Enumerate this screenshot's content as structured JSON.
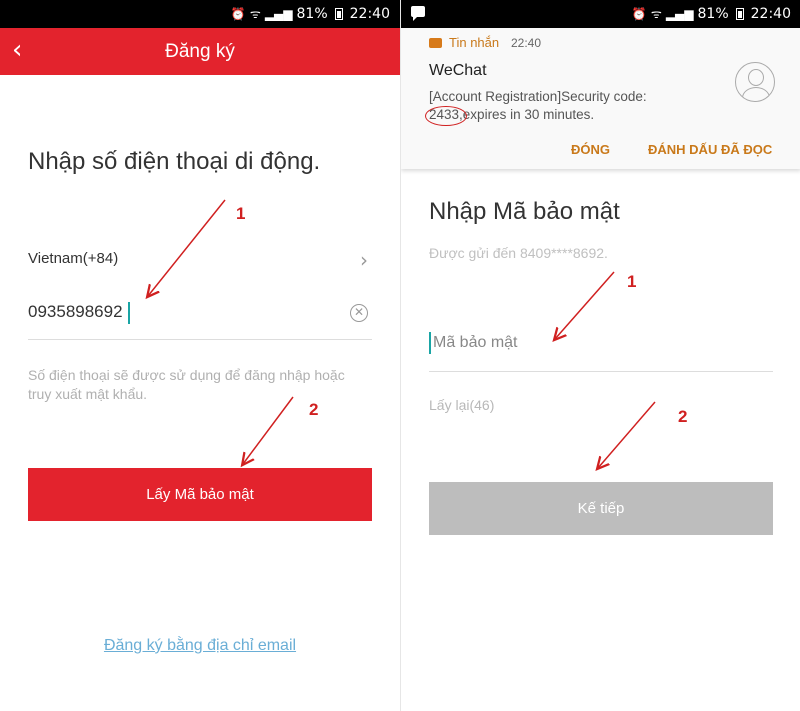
{
  "status_bar": {
    "battery": "81%",
    "time": "22:40"
  },
  "left": {
    "title": "Đăng ký",
    "heading": "Nhập số điện thoại di động.",
    "country": "Vietnam(+84)",
    "phone_value": "0935898692",
    "hint": "Số điện thoại sẽ được sử dụng để đăng nhập hoặc truy xuất mật khẩu.",
    "get_code_button": "Lấy Mã bảo mật",
    "email_link": "Đăng ký bằng địa chỉ email"
  },
  "right": {
    "notification": {
      "app_name": "Tin nhắn",
      "time": "22:40",
      "title": "WeChat",
      "body_line1": "[Account Registration]Security code:",
      "code": "2433",
      "body_line2": ",expires in 30 minutes.",
      "close_action": "ĐÓNG",
      "mark_read_action": "ĐÁNH DẤU ĐÃ ĐỌC"
    },
    "heading": "Nhập Mã bảo mật",
    "sent_to": "Được gửi đến 8409****8692.",
    "code_placeholder": "Mã bảo mật",
    "resend": "Lấy lại(46)",
    "next_button": "Kế tiếp"
  },
  "annotations": {
    "step1": "1",
    "step2": "2"
  },
  "colors": {
    "brand_red": "#e3232d",
    "annotation_red": "#d02020",
    "link_blue": "#6aaed6",
    "disabled_grey": "#bdbdbd"
  }
}
